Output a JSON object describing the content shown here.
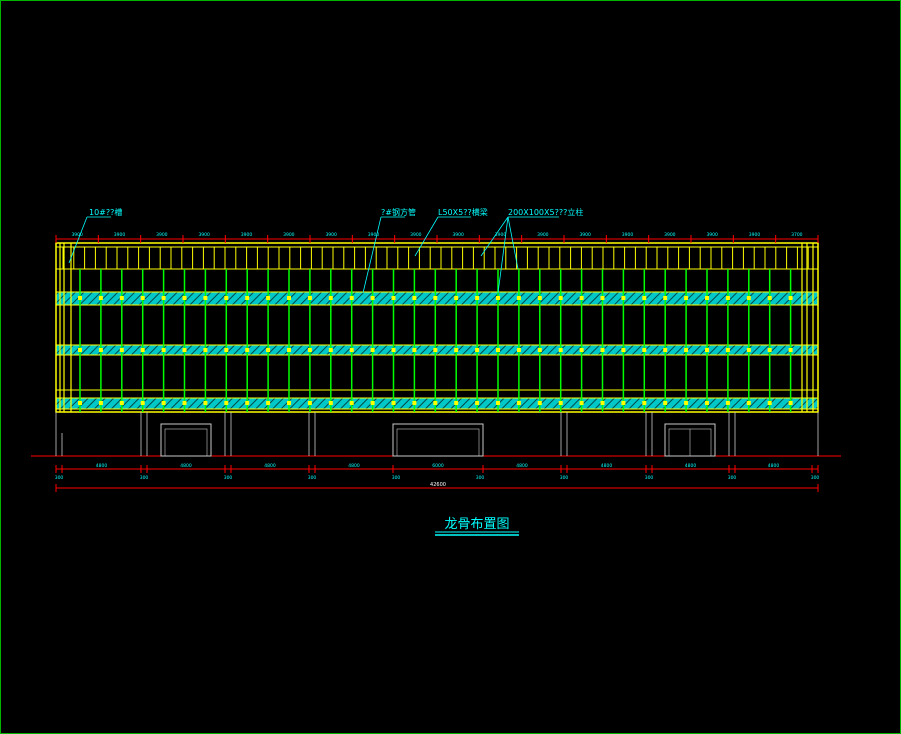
{
  "drawing": {
    "title": "龙骨布置图",
    "colors": {
      "frame": "#00b400",
      "background": "#000000",
      "mullion": "#00ff00",
      "transom": "#ffff00",
      "band": "#00c8c8",
      "dimension": "#ff0000",
      "dim_text": "#00ffff",
      "wall": "#c8c8c8"
    },
    "callouts": [
      {
        "text": "10#??槽"
      },
      {
        "text": "?#钢方管"
      },
      {
        "text": "L50X5??横梁"
      },
      {
        "text": "200X100X5???立柱"
      }
    ],
    "top_dims": [
      "3900",
      "3900",
      "3900",
      "3900",
      "3900",
      "3900",
      "3900",
      "3900",
      "3900",
      "3900",
      "3900",
      "3900",
      "3900",
      "3900",
      "3900",
      "3900",
      "3900",
      "3700"
    ],
    "bottom_dims": [
      "4800",
      "4800",
      "4800",
      "4800",
      "6000",
      "4800",
      "4800",
      "4800",
      "4800"
    ],
    "bottom_sub_dims": [
      "300",
      "300",
      "300",
      "300",
      "300",
      "300",
      "300",
      "300",
      "300",
      "300"
    ],
    "total_dim": "42600"
  }
}
